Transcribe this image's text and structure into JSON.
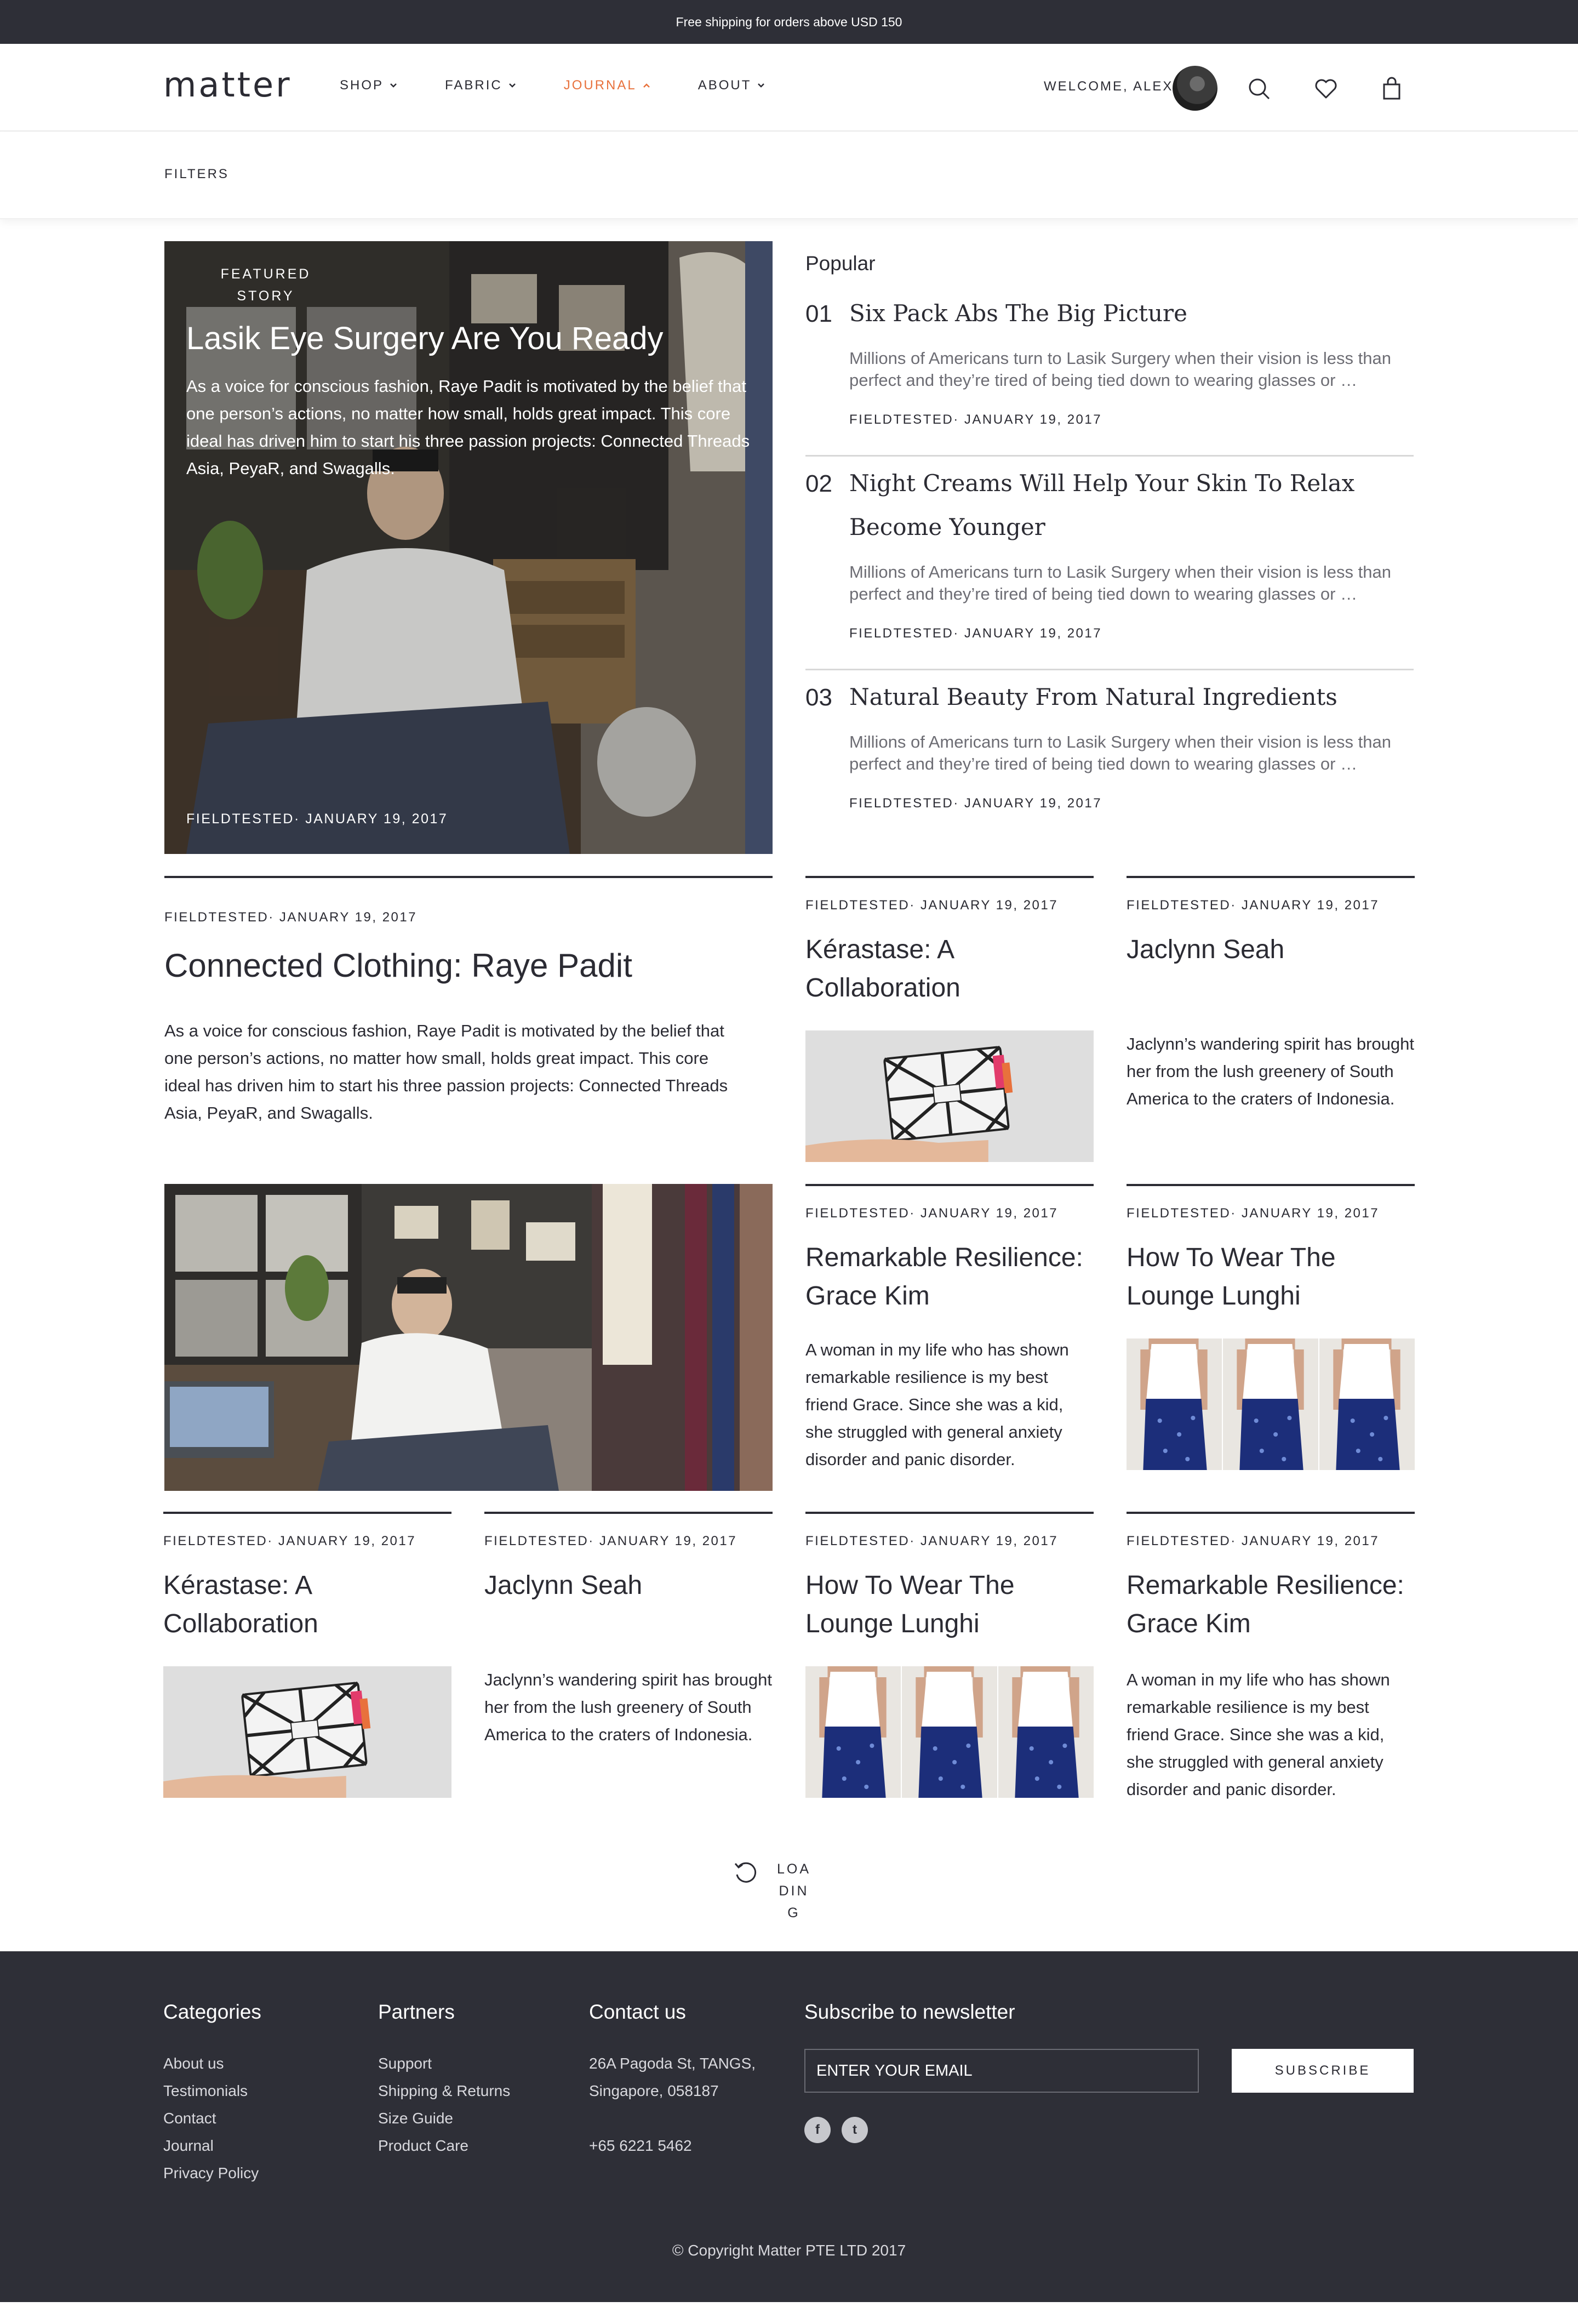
{
  "topbar": {
    "text": "Free shipping for orders above USD 150"
  },
  "header": {
    "logo": "matter",
    "nav": [
      {
        "label": "SHOP",
        "icon": "chevron-down-icon"
      },
      {
        "label": "FABRIC",
        "icon": "chevron-down-icon"
      },
      {
        "label": "JOURNAL",
        "icon": "chevron-up-icon"
      },
      {
        "label": "ABOUT",
        "icon": "chevron-down-icon"
      }
    ],
    "welcome": "WELCOME, ALEX",
    "icons": [
      "search-icon",
      "heart-icon",
      "bag-icon"
    ],
    "accent_color": "#e8713c"
  },
  "filters": {
    "label": "FILTERS"
  },
  "featured": {
    "tag": "FEATURED STORY",
    "title": "Lasik Eye Surgery Are You Ready",
    "description": "As a voice for conscious fashion, Raye Padit is motivated by the belief that one person’s actions, no matter how small, holds great impact. This core ideal has driven him to start his three passion projects: Connected Threads Asia, PeyaR, and Swagalls.",
    "meta": "FIELDTESTED· JANUARY 19, 2017"
  },
  "popular": {
    "heading": "Popular",
    "items": [
      {
        "num": "01",
        "title": "Six Pack Abs The Big Picture",
        "excerpt": "Millions of Americans turn to Lasik Surgery when their vision is less than perfect and they’re tired of being tied down to wearing glasses or …",
        "meta": "FIELDTESTED· JANUARY 19, 2017"
      },
      {
        "num": "02",
        "title": "Night Creams Will Help Your Skin To Relax Become Younger",
        "excerpt": "Millions of Americans turn to Lasik Surgery when their vision is less than perfect and they’re tired of being tied down to wearing glasses or …",
        "meta": "FIELDTESTED· JANUARY 19, 2017"
      },
      {
        "num": "03",
        "title": "Natural Beauty From Natural Ingredients",
        "excerpt": "Millions of Americans turn to Lasik Surgery when their vision is less than perfect and they’re tired of being tied down to wearing glasses or …",
        "meta": "FIELDTESTED· JANUARY 19, 2017"
      }
    ]
  },
  "cards": {
    "connected": {
      "meta": "FIELDTESTED· JANUARY 19, 2017",
      "title": "Connected Clothing: Raye Padit",
      "text": "As a voice for conscious fashion, Raye Padit is motivated by the belief that one person’s actions, no matter how small, holds great impact. This core ideal has driven him to start his three passion projects: Connected Threads Asia, PeyaR, and Swagalls."
    },
    "kerastase": {
      "meta": "FIELDTESTED· JANUARY 19, 2017",
      "title": "Kérastase: A Collaboration"
    },
    "jaclynn": {
      "meta": "FIELDTESTED· JANUARY 19, 2017",
      "title": "Jaclynn Seah",
      "text": "Jaclynn’s wandering spirit has brought her from the lush greenery of South America to the craters of Indonesia."
    },
    "grace": {
      "meta": "FIELDTESTED· JANUARY 19, 2017",
      "title": "Remarkable Resilience: Grace Kim",
      "text": "A woman in my life who has shown remarkable resilience is my best friend Grace. Since she was a kid, she struggled with general anxiety disorder and panic disorder."
    },
    "lunghi": {
      "meta": "FIELDTESTED· JANUARY 19, 2017",
      "title": "How To Wear The Lounge Lunghi"
    }
  },
  "loading": {
    "label": "LOADING"
  },
  "footer": {
    "categories": {
      "heading": "Categories",
      "links": [
        "About us",
        "Testimonials",
        "Contact",
        "Journal",
        "Privacy Policy"
      ]
    },
    "partners": {
      "heading": "Partners",
      "links": [
        "Support",
        "Shipping & Returns",
        "Size Guide",
        "Product Care"
      ]
    },
    "contact": {
      "heading": "Contact us",
      "address1": "26A Pagoda St, TANGS,",
      "address2": "Singapore, 058187",
      "phone": "+65 6221 5462"
    },
    "newsletter": {
      "heading": "Subscribe to newsletter",
      "placeholder": "ENTER YOUR EMAIL",
      "button": "SUBSCRIBE",
      "social": [
        {
          "icon": "facebook-icon",
          "glyph": "f"
        },
        {
          "icon": "twitter-icon",
          "glyph": "t"
        }
      ]
    },
    "copyright": "© Copyright Matter PTE LTD  2017"
  }
}
